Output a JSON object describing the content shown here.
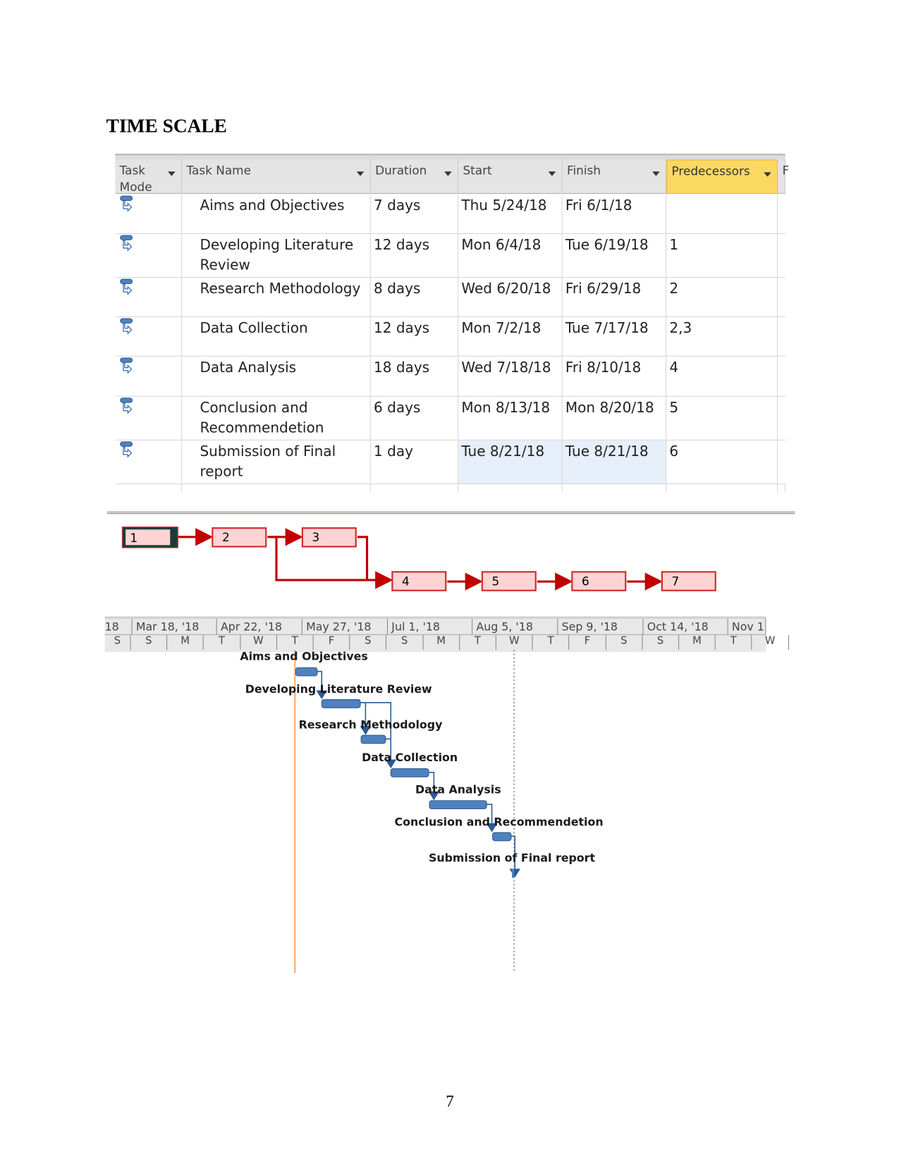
{
  "heading": "TIME SCALE",
  "page_number": "7",
  "table": {
    "columns": [
      {
        "label": "Task Mode",
        "dropdown": true
      },
      {
        "label": "Task Name",
        "dropdown": true
      },
      {
        "label": "Duration",
        "dropdown": true
      },
      {
        "label": "Start",
        "dropdown": true
      },
      {
        "label": "Finish",
        "dropdown": true
      },
      {
        "label": "Predecessors",
        "dropdown": true,
        "highlighted": true
      },
      {
        "label": "F"
      }
    ],
    "task_mode_icon": "auto-scheduled-task-icon",
    "rows": [
      {
        "name": "Aims and Objectives",
        "duration": "7 days",
        "start": "Thu 5/24/18",
        "finish": "Fri 6/1/18",
        "predecessors": ""
      },
      {
        "name": "Developing Literature Review",
        "duration": "12 days",
        "start": "Mon 6/4/18",
        "finish": "Tue 6/19/18",
        "predecessors": "1"
      },
      {
        "name": "Research Methodology",
        "duration": "8 days",
        "start": "Wed 6/20/18",
        "finish": "Fri 6/29/18",
        "predecessors": "2"
      },
      {
        "name": "Data Collection",
        "duration": "12 days",
        "start": "Mon 7/2/18",
        "finish": "Tue 7/17/18",
        "predecessors": "2,3"
      },
      {
        "name": "Data Analysis",
        "duration": "18 days",
        "start": "Wed 7/18/18",
        "finish": "Fri 8/10/18",
        "predecessors": "4"
      },
      {
        "name": "Conclusion and Recommendetion",
        "duration": "6 days",
        "start": "Mon 8/13/18",
        "finish": "Mon 8/20/18",
        "predecessors": "5"
      },
      {
        "name": "Submission of Final report",
        "duration": "1 day",
        "start": "Tue 8/21/18",
        "finish": "Tue 8/21/18",
        "predecessors": "6"
      }
    ]
  },
  "network": {
    "nodes": [
      "1",
      "2",
      "3",
      "4",
      "5",
      "6",
      "7"
    ],
    "colors": {
      "line": "#c00000",
      "fill": "#fdd3d3"
    }
  },
  "gantt": {
    "top_tier": [
      "18",
      "Mar 18, '18",
      "Apr 22, '18",
      "May 27, '18",
      "Jul 1, '18",
      "Aug 5, '18",
      "Sep 9, '18",
      "Oct 14, '18",
      "Nov 1"
    ],
    "bottom_tier": [
      "S",
      "S",
      "M",
      "T",
      "W",
      "T",
      "F",
      "S",
      "S",
      "M",
      "T",
      "W",
      "T",
      "F",
      "S",
      "S",
      "M",
      "T",
      "W"
    ],
    "bars": [
      "Aims and Objectives",
      "Developing Literature Review",
      "Research Methodology",
      "Data Collection",
      "Data Analysis",
      "Conclusion and Recommendetion",
      "Submission of Final report"
    ],
    "colors": {
      "bar": "#4f81bd",
      "today_line": "#f79646"
    }
  }
}
